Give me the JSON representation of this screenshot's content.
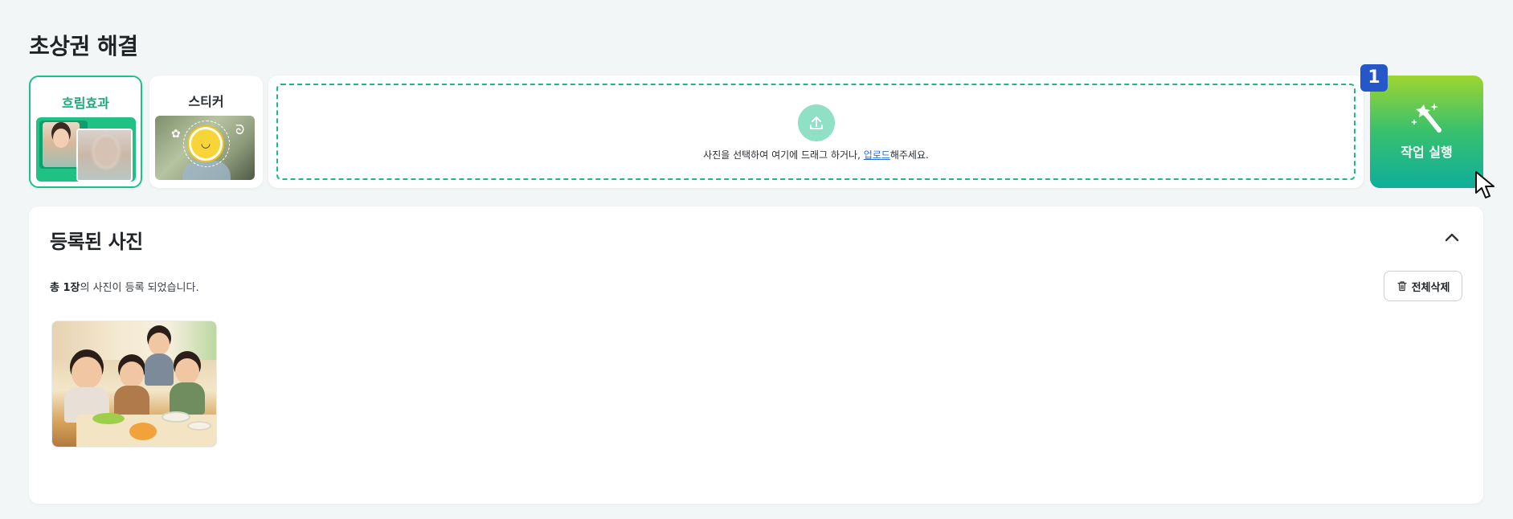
{
  "page": {
    "title": "초상권 해결"
  },
  "modes": [
    {
      "label": "흐림효과",
      "active": true,
      "icon": "blur-face-thumbnail"
    },
    {
      "label": "스티커",
      "active": false,
      "icon": "sticker-face-thumbnail"
    }
  ],
  "upload": {
    "icon": "upload-icon",
    "text_before": "사진을 선택하여 여기에 드래그 하거나, ",
    "link": "업로드",
    "text_after": "해주세요."
  },
  "run": {
    "label": "작업 실행",
    "icon": "magic-wand-icon",
    "badge": "1"
  },
  "registered": {
    "title": "등록된 사진",
    "count_prefix": "총 1장",
    "count_suffix": "의 사진이 등록 되었습니다.",
    "delete_all": "전체삭제",
    "photos": [
      {
        "icon": "children-eating-photo"
      }
    ]
  },
  "colors": {
    "accent": "#1fbf8b",
    "badge": "#2557c9",
    "run_gradient_top": "#9ed52f",
    "run_gradient_bottom": "#0fae9b",
    "link": "#2a6fdb"
  }
}
